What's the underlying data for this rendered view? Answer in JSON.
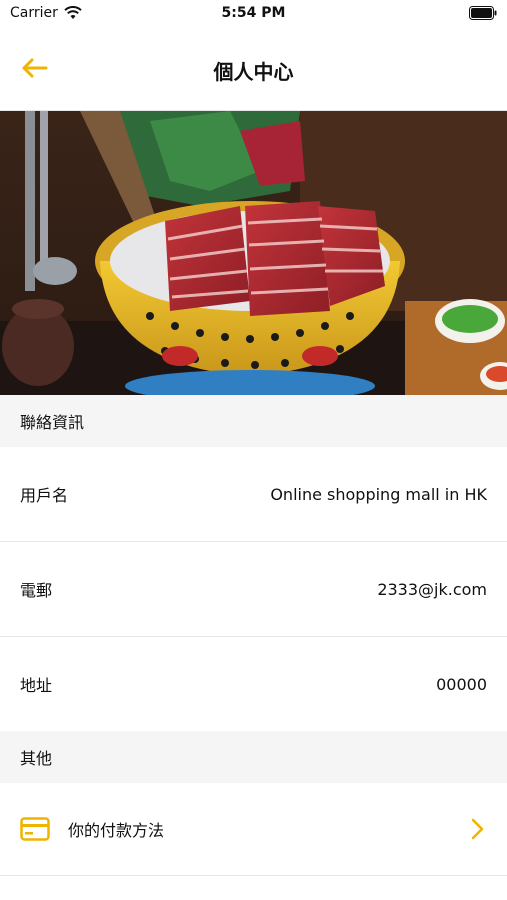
{
  "status_bar": {
    "carrier": "Carrier",
    "time": "5:54 PM"
  },
  "nav": {
    "title": "個人中心"
  },
  "contact": {
    "header": "聯絡資訊",
    "rows": [
      {
        "label": "用戶名",
        "value": "Online shopping mall in HK"
      },
      {
        "label": "電郵",
        "value": "2333@jk.com"
      },
      {
        "label": "地址",
        "value": "00000"
      }
    ]
  },
  "other": {
    "header": "其他",
    "items": [
      {
        "label": "你的付款方法",
        "icon": "credit-card-icon"
      }
    ]
  },
  "colors": {
    "accent": "#f0b400"
  }
}
